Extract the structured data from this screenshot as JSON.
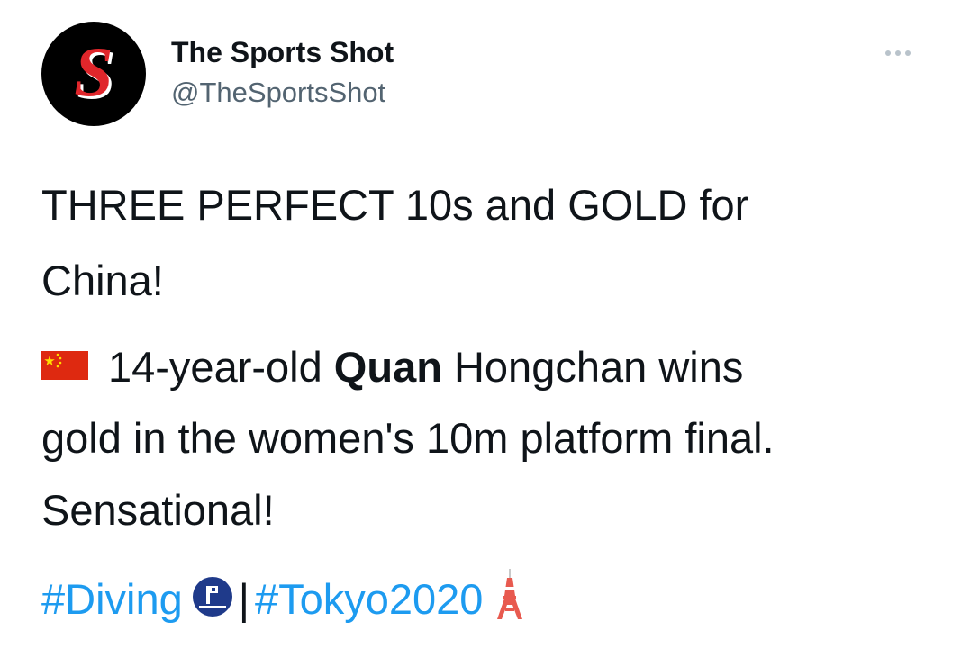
{
  "account": {
    "display_name": "The Sports Shot",
    "handle": "@TheSportsShot",
    "avatar_letter": "S",
    "avatar_icon": "sports-shot-logo",
    "more_icon": "more-options-icon"
  },
  "tweet": {
    "line1": "THREE PERFECT 10s and GOLD for",
    "line2": "China!",
    "flag_icon": "china-flag-emoji",
    "line3_pre": "14-year-old ",
    "line3_bold": "Quan",
    "line3_post": " Hongchan wins",
    "line4": "gold in the women's 10m platform final.",
    "line5": "Sensational!",
    "hashtag_diving": "#Diving",
    "diving_icon": "diving-pictogram-icon",
    "separator": "|",
    "hashtag_tokyo": "#Tokyo2020",
    "tower_icon": "tokyo-tower-icon"
  },
  "colors": {
    "link": "#1d9bf0",
    "text": "#0f1419",
    "secondary": "#536471",
    "avatar_bg": "#000000",
    "avatar_letter": "#e0262b"
  }
}
